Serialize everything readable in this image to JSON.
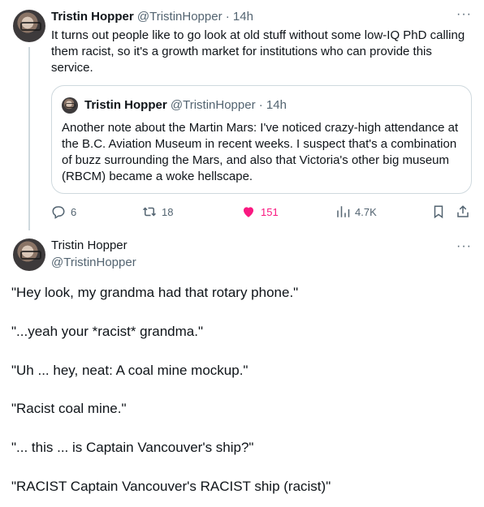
{
  "tweet1": {
    "author_name": "Tristin Hopper",
    "author_handle": "@TristinHopper",
    "separator": "·",
    "timestamp": "14h",
    "text": "It turns out people like to go look at old stuff without some low-IQ PhD calling them racist, so it's a growth market for institutions who can provide this service.",
    "quote": {
      "author_name": "Tristin Hopper",
      "author_handle": "@TristinHopper",
      "separator": "·",
      "timestamp": "14h",
      "text": "Another note about the Martin Mars: I've noticed crazy-high attendance at the B.C. Aviation Museum in recent weeks. I suspect that's a combination of buzz surrounding the Mars, and also that Victoria's other big museum (RBCM) became a woke hellscape."
    },
    "actions": {
      "replies": "6",
      "retweets": "18",
      "likes": "151",
      "views": "4.7K"
    },
    "more_icon": "more-icon",
    "like_color": "#f91880"
  },
  "tweet2": {
    "author_name": "Tristin Hopper",
    "author_handle": "@TristinHopper",
    "paragraphs": [
      "\"Hey look, my grandma had that rotary phone.\"",
      "\"...yeah your *racist* grandma.\"",
      "\"Uh ... hey, neat: A coal mine mockup.\"",
      "\"Racist coal mine.\"",
      "\"... this ... is Captain Vancouver's ship?\"",
      "\"RACIST Captain Vancouver's RACIST ship (racist)\""
    ]
  }
}
